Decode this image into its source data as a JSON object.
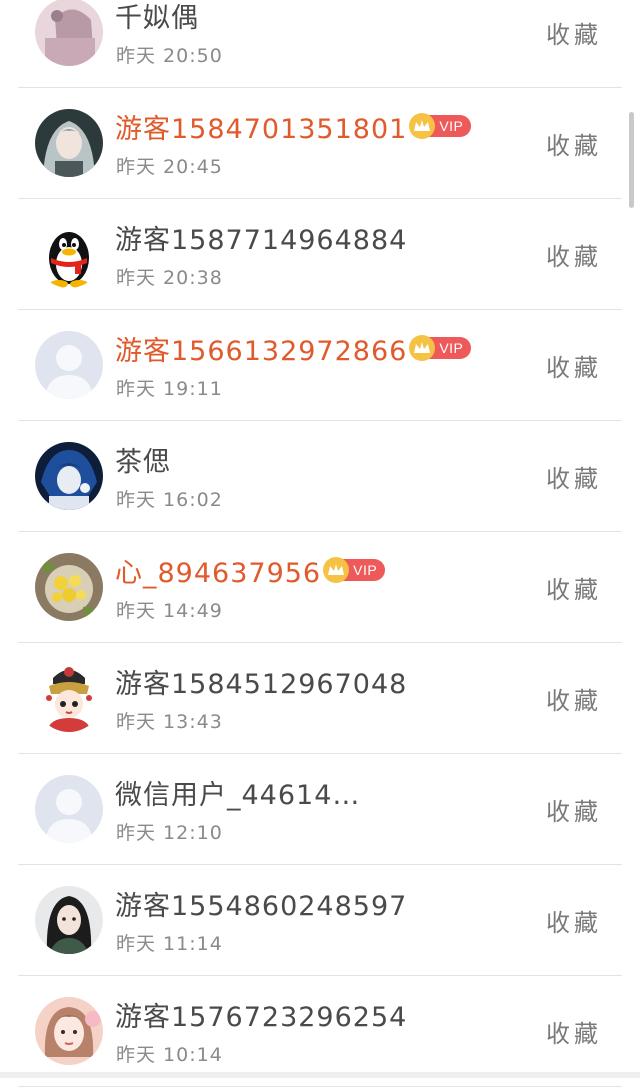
{
  "favorite_label": "收藏",
  "vip_label": "VIP",
  "colors": {
    "vip_name": "#e05a2b",
    "normal_name": "#4a4a4a",
    "vip_tag": "#ee5a5a",
    "crown": "#f6c244"
  },
  "items": [
    {
      "name": "千姒偶",
      "time": "昨天 20:50",
      "vip": false,
      "avatar": "anime-girl-avatar"
    },
    {
      "name": "游客1584701351801",
      "time": "昨天 20:45",
      "vip": true,
      "avatar": "girl-gray-hair-avatar"
    },
    {
      "name": "游客1587714964884",
      "time": "昨天 20:38",
      "vip": false,
      "avatar": "qq-penguin-avatar"
    },
    {
      "name": "游客1566132972866",
      "time": "昨天 19:11",
      "vip": true,
      "avatar": "default-person-avatar"
    },
    {
      "name": "茶偲",
      "time": "昨天 16:02",
      "vip": false,
      "avatar": "girl-blue-hair-avatar"
    },
    {
      "name": "心_894637956",
      "time": "昨天 14:49",
      "vip": true,
      "avatar": "flowers-avatar"
    },
    {
      "name": "游客1584512967048",
      "time": "昨天 13:43",
      "vip": false,
      "avatar": "cartoon-girl-avatar"
    },
    {
      "name": "微信用户_44614…",
      "time": "昨天 12:10",
      "vip": false,
      "avatar": "default-person-avatar"
    },
    {
      "name": "游客1554860248597",
      "time": "昨天 11:14",
      "vip": false,
      "avatar": "girl-dark-hair-avatar"
    },
    {
      "name": "游客1576723296254",
      "time": "昨天 10:14",
      "vip": false,
      "avatar": "girl-portrait-avatar"
    }
  ]
}
